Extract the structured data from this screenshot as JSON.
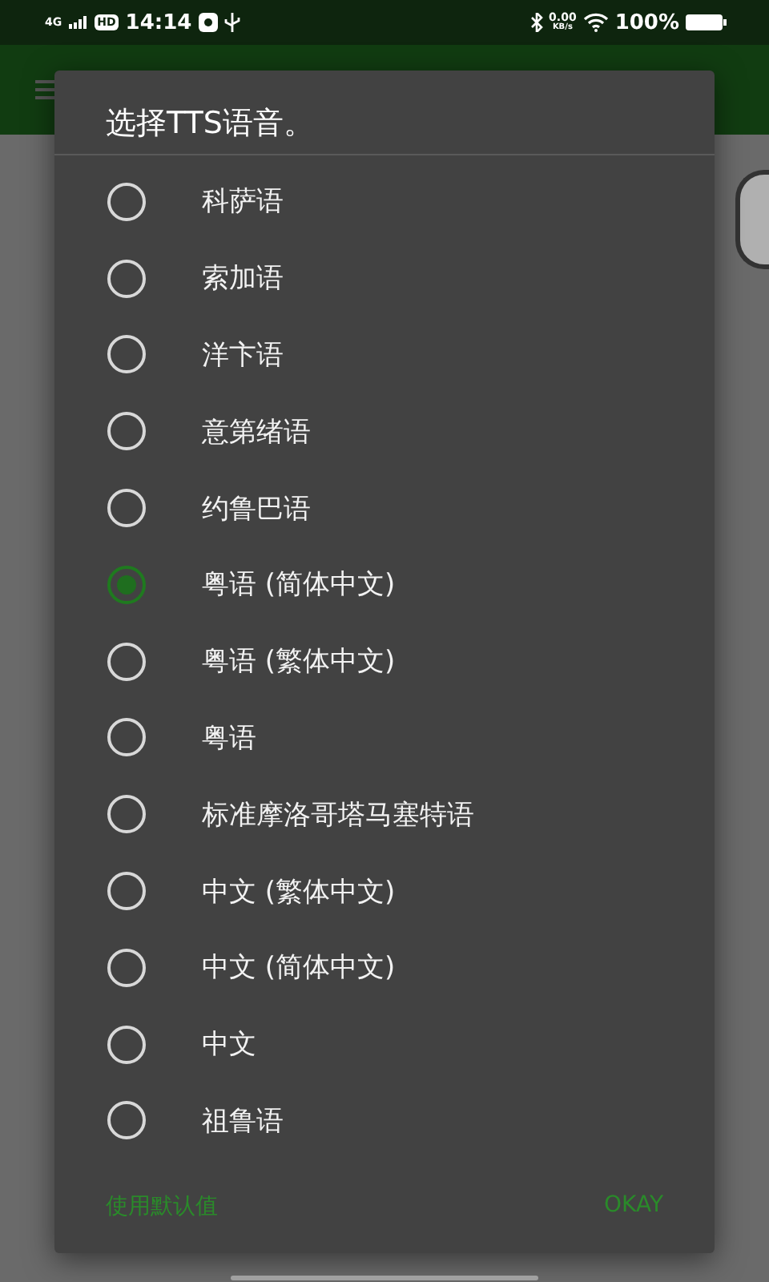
{
  "status_bar": {
    "network": "4G",
    "hd": "HD",
    "time": "14:14",
    "speed": "0.00",
    "speed_unit": "KB/s",
    "battery": "100%"
  },
  "dialog": {
    "title": "选择TTS语音。",
    "options": [
      {
        "label": "科萨语",
        "selected": false
      },
      {
        "label": "索加语",
        "selected": false
      },
      {
        "label": "洋卞语",
        "selected": false
      },
      {
        "label": "意第绪语",
        "selected": false
      },
      {
        "label": "约鲁巴语",
        "selected": false
      },
      {
        "label": "粤语 (简体中文)",
        "selected": true
      },
      {
        "label": "粤语 (繁体中文)",
        "selected": false
      },
      {
        "label": "粤语",
        "selected": false
      },
      {
        "label": "标准摩洛哥塔马塞特语",
        "selected": false
      },
      {
        "label": "中文 (繁体中文)",
        "selected": false
      },
      {
        "label": "中文 (简体中文)",
        "selected": false
      },
      {
        "label": "中文",
        "selected": false
      },
      {
        "label": "祖鲁语",
        "selected": false
      }
    ],
    "buttons": [
      "使用默认值",
      "OKAY"
    ]
  }
}
